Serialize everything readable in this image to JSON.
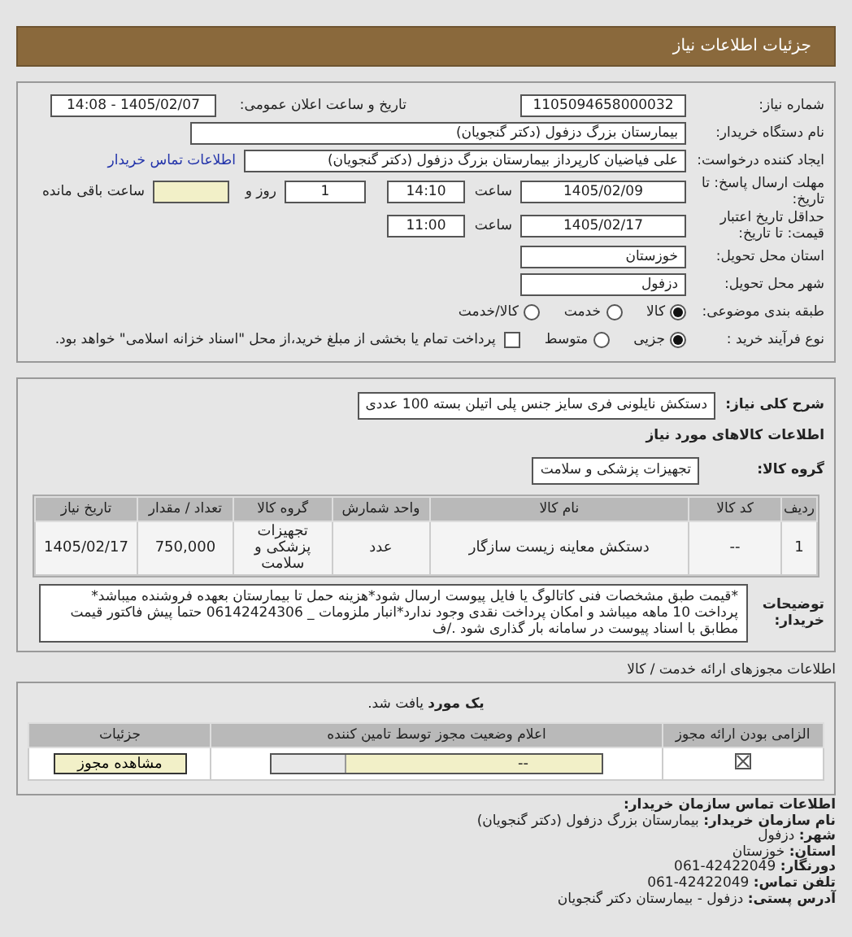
{
  "header": {
    "title": "جزئیات اطلاعات نیاز"
  },
  "need": {
    "number": {
      "label": "شماره نیاز:",
      "value": "1105094658000032"
    },
    "announce": {
      "label": "تاریخ و ساعت اعلان عمومی:",
      "value": "1405/02/07 - 14:08"
    },
    "buyer": {
      "label": "نام دستگاه خریدار:",
      "value": "بیمارستان بزرگ دزفول (دکتر گنجویان)"
    },
    "requester": {
      "label": "ایجاد کننده درخواست:",
      "value": "علی فیاضیان کارپرداز بیمارستان بزرگ دزفول (دکتر گنجویان)",
      "link": "اطلاعات تماس خریدار"
    },
    "deadline": {
      "label": "مهلت ارسال پاسخ: تا تاریخ:",
      "date": "1405/02/09",
      "time_label": "ساعت",
      "time": "14:10",
      "days": "1",
      "days_label": "روز و",
      "remaining_label": "ساعت باقی مانده"
    },
    "validity": {
      "label": "حداقل تاریخ اعتبار قیمت: تا تاریخ:",
      "date": "1405/02/17",
      "time_label": "ساعت",
      "time": "11:00"
    },
    "province": {
      "label": "استان محل تحویل:",
      "value": "خوزستان"
    },
    "city": {
      "label": "شهر محل تحویل:",
      "value": "دزفول"
    },
    "category": {
      "label": "طبقه بندی موضوعی:",
      "options": [
        {
          "label": "کالا",
          "selected": true
        },
        {
          "label": "خدمت",
          "selected": false
        },
        {
          "label": "کالا/خدمت",
          "selected": false
        }
      ]
    },
    "process": {
      "label": "نوع فرآیند خرید :",
      "options": [
        {
          "label": "جزیی",
          "selected": true
        },
        {
          "label": "متوسط",
          "selected": false
        }
      ],
      "payment": {
        "label": "پرداخت تمام یا بخشی از مبلغ خرید،از محل \"اسناد خزانه اسلامی\" خواهد بود.",
        "checked": false
      }
    }
  },
  "details": {
    "summary": {
      "label": "شرح کلی نیاز:",
      "value": "دستکش نایلونی فری سایز جنس پلی اتیلن بسته 100 عددی"
    },
    "goods_title": "اطلاعات کالاهای مورد نیاز",
    "goods_group": {
      "label": "گروه کالا:",
      "value": "تجهیزات پزشکی و سلامت"
    },
    "goods_table": {
      "columns": [
        "ردیف",
        "کد کالا",
        "نام کالا",
        "واحد شمارش",
        "گروه کالا",
        "تعداد / مقدار",
        "تاریخ نیاز"
      ],
      "rows": [
        [
          "1",
          "--",
          "دستکش معاینه زیست سازگار",
          "عدد",
          "تجهیزات پزشکی و سلامت",
          "750,000",
          "1405/02/17"
        ]
      ]
    },
    "notes": {
      "label": "توضیحات خریدار:",
      "text": "*قیمت طبق مشخصات فنی کاتالوگ یا فایل پیوست ارسال شود*هزینه حمل تا بیمارستان بعهده فروشنده میباشد* پرداخت 10 ماهه میباشد و امکان پرداخت نقدی وجود ندارد*انبار ملزومات _ 06142424306 حتما پیش فاکتور قیمت مطابق با اسناد پیوست در سامانه بار گذاری شود ./ف"
    }
  },
  "permits": {
    "title": "اطلاعات مجوزهای ارائه خدمت / کالا",
    "found_text": "**یک مورد** یافت شد.",
    "columns": [
      "الزامی بودن ارائه مجوز",
      "اعلام وضعیت مجوز توسط تامین کننده",
      "جزئیات"
    ],
    "rows": [
      {
        "required": true,
        "status": "--",
        "button": "مشاهده مجوز"
      }
    ]
  },
  "contact": {
    "title": "اطلاعات تماس سازمان خریدار:",
    "lines": [
      {
        "label": "نام سازمان خریدار:",
        "value": "بیمارستان بزرگ دزفول (دکتر گنجویان)"
      },
      {
        "label": "شهر:",
        "value": "دزفول"
      },
      {
        "label": "استان:",
        "value": "خوزستان"
      },
      {
        "label": "دورنگار:",
        "value": "42422049-061"
      },
      {
        "label": "تلفن تماس:",
        "value": "42422049-061"
      },
      {
        "label": "آدرس پستی:",
        "value": "دزفول - بیمارستان دکتر گنجویان"
      }
    ]
  }
}
